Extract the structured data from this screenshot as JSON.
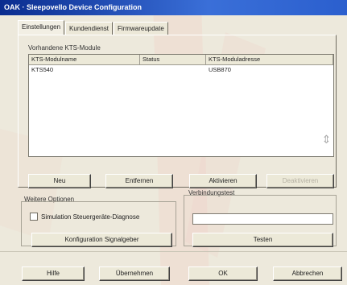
{
  "window": {
    "title": "OAK · Sleepovello Device Configuration"
  },
  "tabs": [
    {
      "label": "Einstellungen",
      "active": true
    },
    {
      "label": "Kundendienst",
      "active": false
    },
    {
      "label": "Firmwareupdate",
      "active": false
    }
  ],
  "modules_group": {
    "label": "Vorhandene KTS-Module",
    "columns": [
      "KTS-Modulname",
      "Status",
      "KTS-Moduladresse"
    ],
    "rows": [
      [
        "KTS540",
        "",
        "USB870"
      ]
    ]
  },
  "module_buttons": {
    "new": "Neu",
    "remove": "Entfernen",
    "activate": "Aktivieren",
    "deactivate": "Deaktivieren"
  },
  "further_options": {
    "label": "Weitere Optionen",
    "checkbox_label": "Simulation Steuergeräte-Diagnose",
    "checkbox_checked": false,
    "config_button": "Konfiguration Signalgeber"
  },
  "connection_test": {
    "label": "Verbindungstest",
    "value": "",
    "test_button": "Testen"
  },
  "footer_buttons": {
    "help": "Hilfe",
    "apply": "Übernehmen",
    "ok": "OK",
    "cancel": "Abbrechen"
  },
  "colors": {
    "titlebar": "#0a2c8f",
    "face": "#ede9dc",
    "watermark": "#e9b0a6"
  }
}
